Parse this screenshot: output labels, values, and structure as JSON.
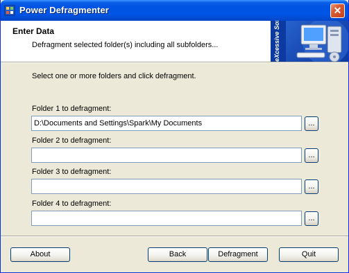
{
  "window": {
    "title": "Power Defragmenter"
  },
  "header": {
    "title": "Enter Data",
    "subtitle": "Defragment selected folder(s) including all subfolders...",
    "banner_text": "eXcessive Software"
  },
  "main": {
    "instruction": "Select one or more folders and click defragment.",
    "folders": [
      {
        "label": "Folder 1 to defragment:",
        "value": "D:\\Documents and Settings\\Spark\\My Documents",
        "browse_label": "..."
      },
      {
        "label": "Folder 2 to defragment:",
        "value": "",
        "browse_label": "..."
      },
      {
        "label": "Folder 3 to defragment:",
        "value": "",
        "browse_label": "..."
      },
      {
        "label": "Folder 4 to defragment:",
        "value": "",
        "browse_label": "..."
      }
    ]
  },
  "footer": {
    "about_label": "About",
    "back_label": "Back",
    "defragment_label": "Defragment",
    "quit_label": "Quit"
  },
  "colors": {
    "titlebar": "#0054e3",
    "dialog_bg": "#ece9d8",
    "button_border": "#003c74",
    "banner": "#1c4fb8"
  }
}
